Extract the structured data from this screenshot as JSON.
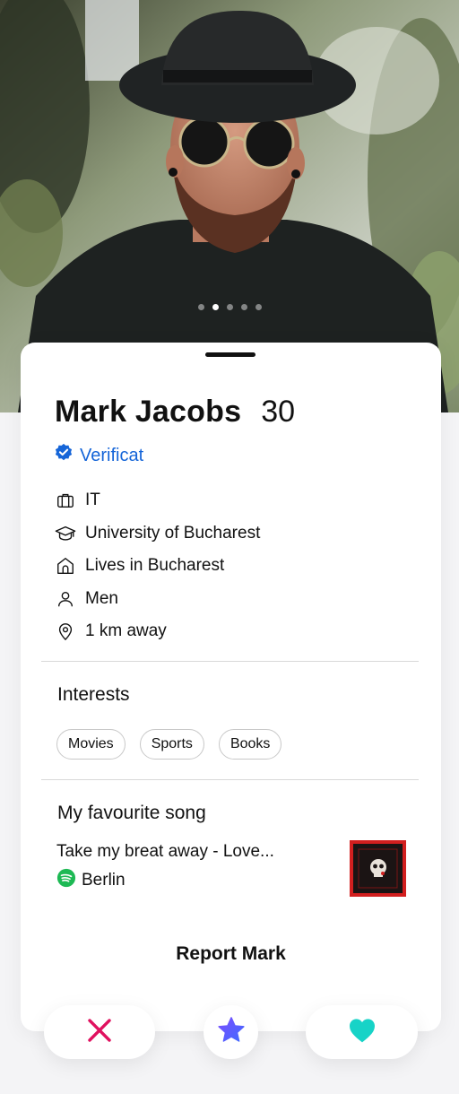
{
  "profile": {
    "name": "Mark Jacobs",
    "age": "30",
    "verified_label": "Verificat",
    "photo_count": 5,
    "active_photo_index": 1
  },
  "info": [
    {
      "icon": "briefcase-icon",
      "text": "IT"
    },
    {
      "icon": "graduation-cap-icon",
      "text": "University of Bucharest"
    },
    {
      "icon": "home-icon",
      "text": "Lives in Bucharest"
    },
    {
      "icon": "person-icon",
      "text": "Men"
    },
    {
      "icon": "location-pin-icon",
      "text": "1 km away"
    }
  ],
  "interests": {
    "title": "Interests",
    "items": [
      "Movies",
      "Sports",
      "Books"
    ]
  },
  "song": {
    "section_title": "My favourite song",
    "title": "Take my breat away - Love...",
    "artist": "Berlin"
  },
  "report_label": "Report Mark",
  "colors": {
    "verified": "#1565d8",
    "dislike": "#e0115f",
    "superlike_from": "#7b4dff",
    "superlike_to": "#3f6bff",
    "like": "#17d3c7",
    "spotify": "#1db954"
  }
}
